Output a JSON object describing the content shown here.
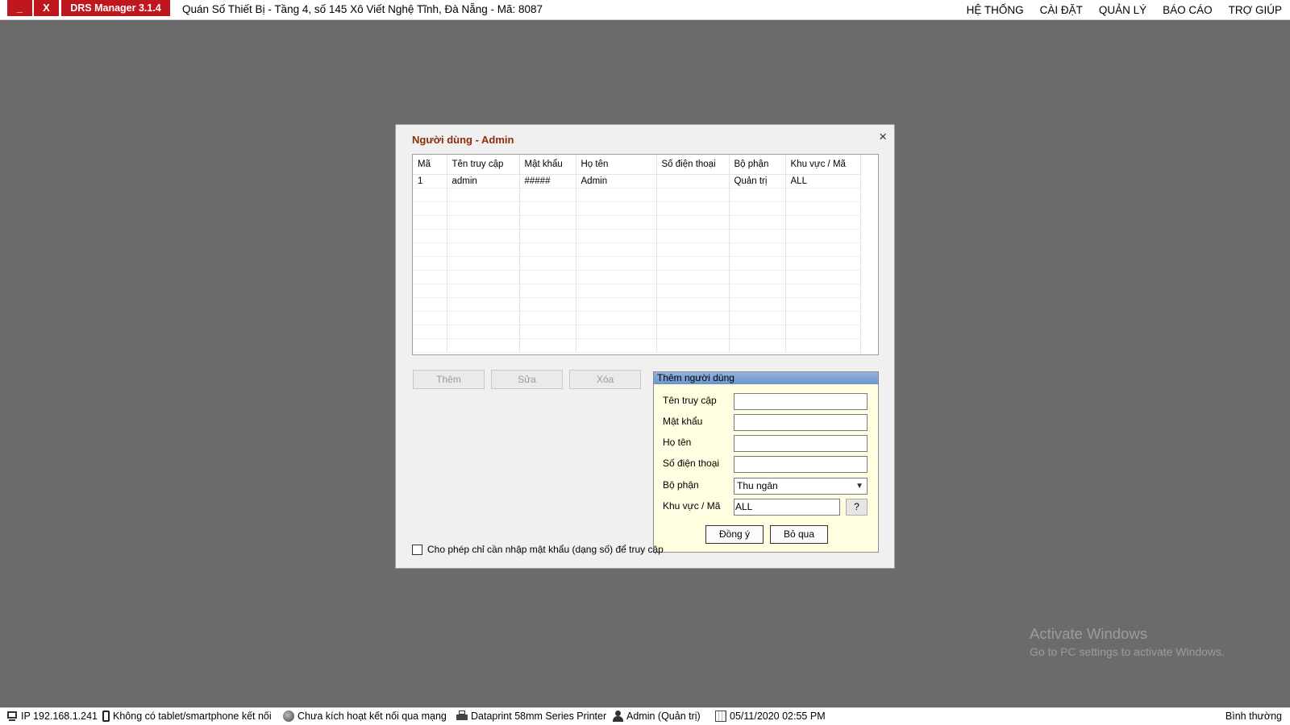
{
  "titlebar": {
    "minimize_label": "_",
    "close_label": "X",
    "app_title": "DRS Manager 3.1.4",
    "shop_info": "Quán Số Thiết Bị  -  Tầng 4, số 145 Xô Viết Nghệ Tĩnh, Đà Nẵng  -  Mã: 8087"
  },
  "menu": [
    "HỆ THỐNG",
    "CÀI ĐẶT",
    "QUẢN LÝ",
    "BÁO CÁO",
    "TRỢ GIÚP"
  ],
  "dialog": {
    "title": "Người dùng - Admin",
    "close_label": "×",
    "table": {
      "columns": [
        "Mã",
        "Tên truy cập",
        "Mật khẩu",
        "Họ tên",
        "Số điện thoại",
        "Bộ phận",
        "Khu vực / Mã"
      ],
      "rows": [
        [
          "1",
          "admin",
          "#####",
          "Admin",
          "",
          "Quản trị",
          "ALL"
        ]
      ]
    },
    "buttons": {
      "add": "Thêm",
      "edit": "Sửa",
      "delete": "Xóa"
    },
    "add_panel": {
      "title": "Thêm người dùng",
      "fields": {
        "username_label": "Tên truy cập",
        "password_label": "Mật khẩu",
        "fullname_label": "Họ tên",
        "phone_label": "Số điện thoại",
        "department_label": "Bộ phận",
        "department_value": "Thu ngân",
        "area_label": "Khu vực / Mã",
        "area_value": "ALL",
        "area_help": "?"
      },
      "ok_label": "Đồng ý",
      "skip_label": "Bỏ qua"
    },
    "checkbox_label": "Cho phép chỉ cần nhập mật khẩu (dạng số) để truy cập",
    "checkbox_checked": false
  },
  "watermark": {
    "line1": "Activate Windows",
    "line2": "Go to PC settings to activate Windows."
  },
  "statusbar": {
    "ip": "IP 192.168.1.241",
    "tablet": "Không có tablet/smartphone kết nối",
    "network": "Chưa kích hoạt kết nối qua mạng",
    "printer": "Dataprint 58mm Series Printer",
    "user": "Admin (Quản trị)",
    "datetime": "05/11/2020 02:55 PM",
    "mode": "Bình thường"
  },
  "colors": {
    "desktop_bg": "#6b6b6b",
    "accent_red": "#c0171f",
    "dialog_title": "#8a2e0e",
    "panel_bg": "#fffee0",
    "panel_header": "#7aa0d4"
  }
}
